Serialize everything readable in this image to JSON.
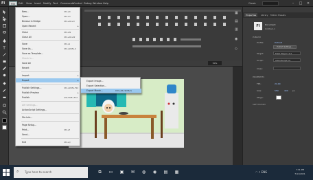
{
  "app": {
    "logo": "Fl"
  },
  "menubar": {
    "items": [
      "File",
      "Edit",
      "View",
      "Insert",
      "Modify",
      "Text",
      "Commands",
      "Control",
      "Debug",
      "Window",
      "Help"
    ],
    "active_index": 0,
    "workspace": "Classic",
    "window_buttons": [
      "–",
      "□",
      "×"
    ]
  },
  "file_menu": {
    "items": [
      {
        "label": "New...",
        "shortcut": "Ctrl+N",
        "disabled": false
      },
      {
        "label": "Open...",
        "shortcut": "Ctrl+O",
        "disabled": false
      },
      {
        "label": "Browse in Bridge",
        "shortcut": "Ctrl+Alt+O",
        "disabled": false
      },
      {
        "label": "Open Recent",
        "shortcut": "",
        "disabled": false,
        "submenu": true
      },
      {
        "label": "Close",
        "shortcut": "Ctrl+W",
        "disabled": false
      },
      {
        "label": "Close All",
        "shortcut": "Ctrl+Alt+W",
        "disabled": false
      },
      {
        "label": "Save",
        "shortcut": "Ctrl+S",
        "disabled": false
      },
      {
        "label": "Save As...",
        "shortcut": "Ctrl+Shift+S",
        "disabled": false
      },
      {
        "label": "Save as Template...",
        "shortcut": "",
        "disabled": false
      },
      {
        "label": "Check In...",
        "shortcut": "",
        "disabled": true
      },
      {
        "label": "Save All",
        "shortcut": "",
        "disabled": false
      },
      {
        "label": "Revert",
        "shortcut": "",
        "disabled": false
      },
      {
        "label": "Import",
        "shortcut": "",
        "disabled": false,
        "submenu": true
      },
      {
        "label": "Export",
        "shortcut": "",
        "disabled": false,
        "submenu": true,
        "highlight": true
      },
      {
        "label": "Publish Settings...",
        "shortcut": "Ctrl+Shift+F12",
        "disabled": false
      },
      {
        "label": "Publish Preview",
        "shortcut": "",
        "disabled": false,
        "submenu": true
      },
      {
        "label": "Publish",
        "shortcut": "Alt+Shift+F12",
        "disabled": false
      },
      {
        "label": "AIR Settings...",
        "shortcut": "",
        "disabled": true
      },
      {
        "label": "ActionScript Settings...",
        "shortcut": "",
        "disabled": false
      },
      {
        "label": "File Info...",
        "shortcut": "",
        "disabled": false
      },
      {
        "label": "Page Setup...",
        "shortcut": "",
        "disabled": false
      },
      {
        "label": "Print...",
        "shortcut": "Ctrl+P",
        "disabled": false
      },
      {
        "label": "Send...",
        "shortcut": "",
        "disabled": false
      },
      {
        "label": "Exit",
        "shortcut": "Ctrl+Q",
        "disabled": false
      }
    ]
  },
  "export_submenu": {
    "items": [
      {
        "label": "Export Image...",
        "shortcut": ""
      },
      {
        "label": "Export Selection...",
        "shortcut": ""
      },
      {
        "label": "Export Movie...",
        "shortcut": "Ctrl+Alt+Shift+S",
        "highlight": true
      }
    ]
  },
  "stage": {
    "zoom": "50%"
  },
  "properties_panel": {
    "tabs": [
      "Properties",
      "Library",
      "Motion Presets"
    ],
    "badge": "Fl",
    "doc_type": "Document",
    "doc_name": "Untitled-1",
    "section_publish": "PUBLISH",
    "profile_label": "Profile:",
    "profile_value": "Default",
    "publish_settings_button": "Publish Settings...",
    "target_label": "Target:",
    "target_value": "Flash Player 11.2",
    "script_label": "Script:",
    "script_value": "ActionScript 3.0",
    "class_label": "Class:",
    "section_properties": "PROPERTIES",
    "fps_label": "FPS:",
    "fps_value": "24.00",
    "size_label": "Size:",
    "size_w": "550",
    "size_h": "400",
    "size_unit": "px",
    "stage_label": "Stage:",
    "section_swf_history": "SWF HISTORY"
  },
  "taskbar": {
    "search_placeholder": "Type here to search",
    "clock_time": "7:31 PM",
    "clock_date": "7/11/2021",
    "lang": "ENG"
  },
  "colors": {
    "menu_highlight": "#99c8ef",
    "wall": "#d7ecc6",
    "curtain": "#25b9b3",
    "table": "#c8823c"
  }
}
